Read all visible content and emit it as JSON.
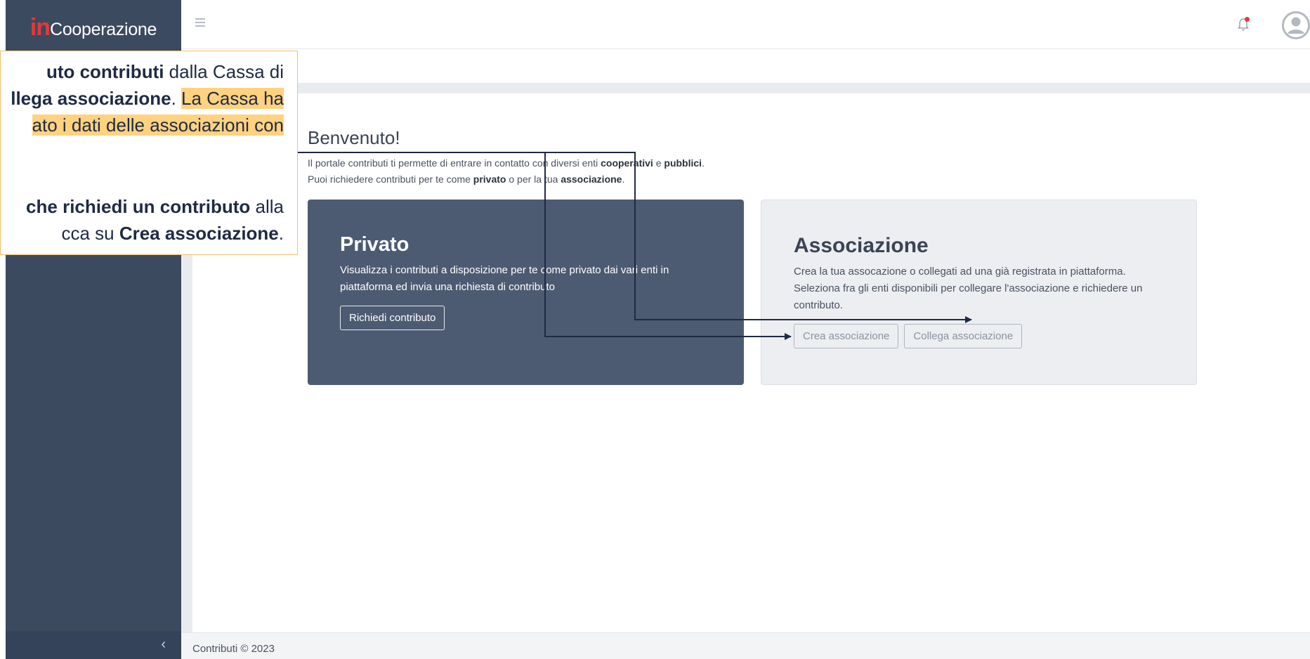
{
  "app": {
    "logo_in": "in",
    "logo_rest": "Cooperazione"
  },
  "topbar": {
    "menu_icon": "hamburger-icon",
    "notification_icon": "bell-icon",
    "avatar_icon": "user-avatar-icon"
  },
  "welcome": {
    "title": "Benvenuto!",
    "line1_a": "Il portale contributi ti permette di entrare in contatto con diversi enti ",
    "line1_b": "cooperativi",
    "line1_c": " e ",
    "line1_d": "pubblici",
    "line1_e": ".",
    "line2_a": "Puoi richiedere contributi per te come ",
    "line2_b": "privato",
    "line2_c": " o per la tua ",
    "line2_d": "associazione",
    "line2_e": "."
  },
  "cards": {
    "private": {
      "title": "Privato",
      "description": "Visualizza i contributi a disposizione per te come privato dai vari enti in piattaforma ed invia una richiesta di contributo",
      "button": "Richiedi contributo"
    },
    "association": {
      "title": "Associazione",
      "description": "Crea la tua assocazione o collegati ad una già registrata in piattaforma. Seleziona fra gli enti disponibili per collegare l'associazione e richiedere un contributo.",
      "button_create": "Crea associazione",
      "button_link": "Collega associazione"
    }
  },
  "footer": {
    "text": "Contributi © 2023"
  },
  "sidebar": {
    "collapse_icon": "chevron-left-icon"
  },
  "callout": {
    "l1_a": "uto contributi",
    "l1_b": " dalla Cassa di",
    "l2_a": "llega associazione",
    "l2_b": ". ",
    "l2_c": "La Cassa ha",
    "l3": "ato i dati delle associazioni con",
    "l4_a": "che richiedi un contributo",
    "l4_b": " alla",
    "l5_a": "cca su ",
    "l5_b": "Crea associazione",
    "l5_c": "."
  },
  "colors": {
    "sidebar": "#3c4a5f",
    "accent_red": "#e13a3a",
    "callout_border": "#f3c06a",
    "highlight": "#ffd27f",
    "arrow": "#1f2a44"
  }
}
